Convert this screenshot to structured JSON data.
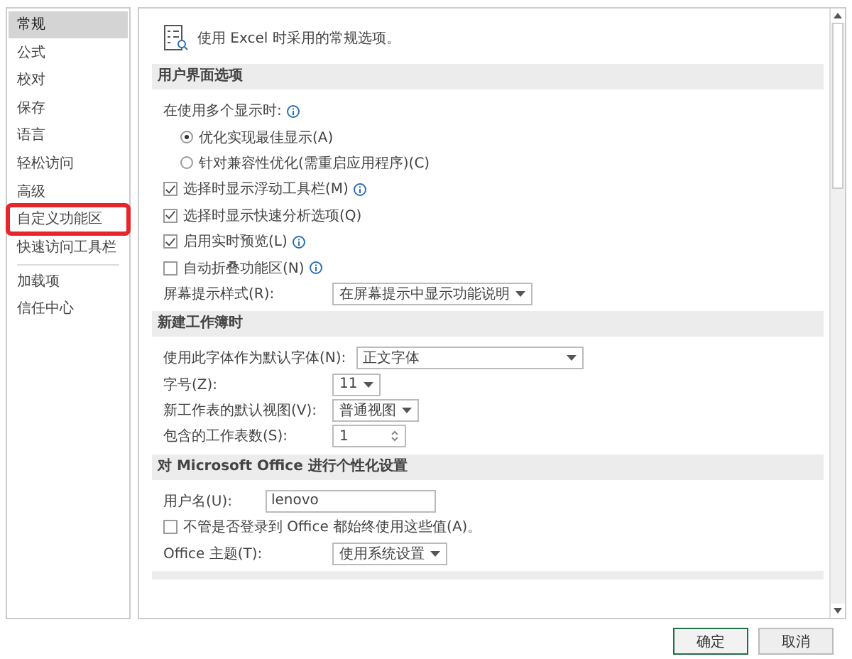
{
  "sidebar": {
    "items": [
      {
        "label": "常规",
        "selected": true,
        "highlighted": false
      },
      {
        "label": "公式",
        "selected": false,
        "highlighted": false
      },
      {
        "label": "校对",
        "selected": false,
        "highlighted": false
      },
      {
        "label": "保存",
        "selected": false,
        "highlighted": false
      },
      {
        "label": "语言",
        "selected": false,
        "highlighted": false
      },
      {
        "label": "轻松访问",
        "selected": false,
        "highlighted": false
      },
      {
        "label": "高级",
        "selected": false,
        "highlighted": false
      },
      {
        "label": "自定义功能区",
        "selected": false,
        "highlighted": true
      },
      {
        "label": "快速访问工具栏",
        "selected": false,
        "highlighted": false,
        "divider_after": true
      },
      {
        "label": "加载项",
        "selected": false,
        "highlighted": false
      },
      {
        "label": "信任中心",
        "selected": false,
        "highlighted": false
      }
    ]
  },
  "intro": "使用 Excel 时采用的常规选项。",
  "sections": [
    {
      "title": "用户界面选项",
      "items": [
        {
          "kind": "label",
          "label": "在使用多个显示时:",
          "info": true
        },
        {
          "kind": "radio",
          "label": "优化实现最佳显示(A)",
          "selected": true
        },
        {
          "kind": "radio",
          "label": "针对兼容性优化(需重启应用程序)(C)",
          "selected": false
        },
        {
          "kind": "checkbox",
          "label": "选择时显示浮动工具栏(M)",
          "checked": true,
          "info": true
        },
        {
          "kind": "checkbox",
          "label": "选择时显示快速分析选项(Q)",
          "checked": true
        },
        {
          "kind": "checkbox",
          "label": "启用实时预览(L)",
          "checked": true,
          "info": true
        },
        {
          "kind": "checkbox",
          "label": "自动折叠功能区(N)",
          "checked": false,
          "info": true
        },
        {
          "kind": "select",
          "label": "屏幕提示样式(R):",
          "value": "在屏幕提示中显示功能说明"
        }
      ]
    },
    {
      "title": "新建工作簿时",
      "items": [
        {
          "kind": "combo",
          "label": "使用此字体作为默认字体(N):",
          "value": "正文字体"
        },
        {
          "kind": "select",
          "label": "字号(Z):",
          "value": "11"
        },
        {
          "kind": "select",
          "label": "新工作表的默认视图(V):",
          "value": "普通视图"
        },
        {
          "kind": "spin",
          "label": "包含的工作表数(S):",
          "value": "1"
        }
      ]
    },
    {
      "title": "对 Microsoft Office 进行个性化设置",
      "items": [
        {
          "kind": "text",
          "label": "用户名(U):",
          "value": "lenovo"
        },
        {
          "kind": "checkbox",
          "label": "不管是否登录到 Office 都始终使用这些值(A)。",
          "checked": false
        },
        {
          "kind": "select",
          "label": "Office 主题(T):",
          "value": "使用系统设置"
        }
      ]
    }
  ],
  "buttons": [
    {
      "label": "确定",
      "primary": true
    },
    {
      "label": "取消",
      "primary": false
    }
  ]
}
